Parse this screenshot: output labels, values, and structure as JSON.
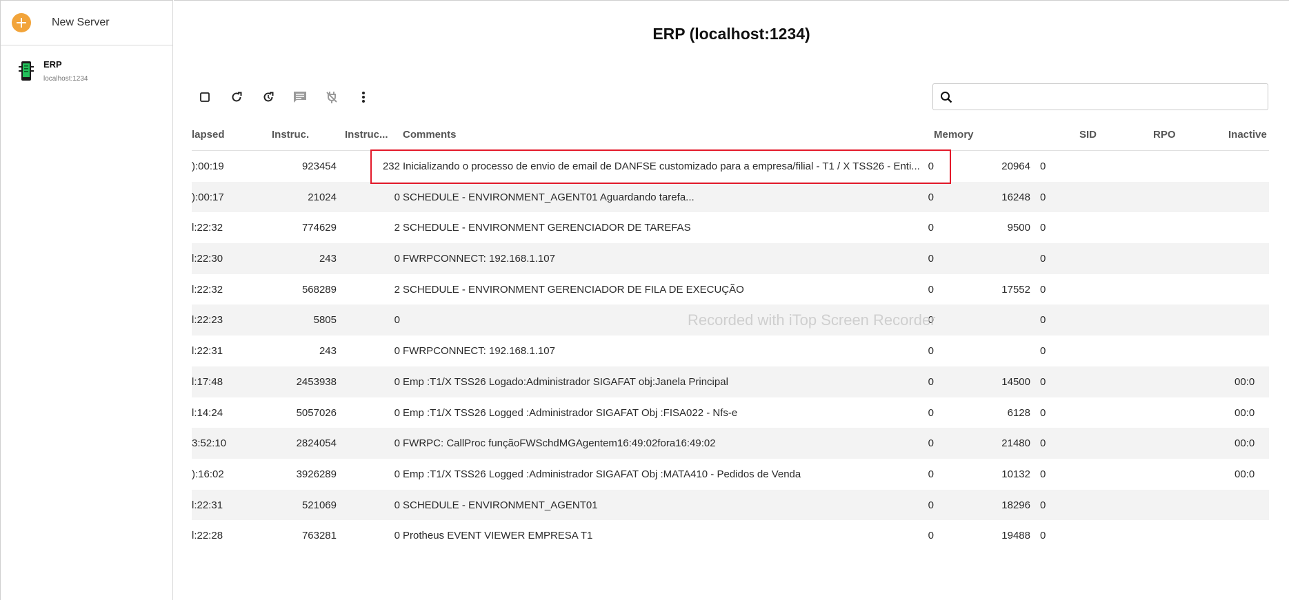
{
  "sidebar": {
    "new_server_label": "New Server",
    "servers": [
      {
        "name": "ERP",
        "host": "localhost:1234",
        "icon": "server-icon"
      }
    ]
  },
  "header": {
    "title": "ERP (localhost:1234)"
  },
  "toolbar": {
    "buttons": [
      {
        "name": "select-all-checkbox",
        "icon": "checkbox-icon"
      },
      {
        "name": "refresh-button",
        "icon": "refresh-icon"
      },
      {
        "name": "auto-refresh-button",
        "icon": "timer-refresh-icon"
      },
      {
        "name": "send-message-button",
        "icon": "message-icon"
      },
      {
        "name": "disconnect-button",
        "icon": "unplug-icon"
      },
      {
        "name": "more-button",
        "icon": "more-vertical-icon"
      }
    ]
  },
  "search": {
    "placeholder": "",
    "value": ""
  },
  "table": {
    "headers": {
      "elapsed": "lapsed",
      "instructions": "Instruc.",
      "instructions2": "Instruc...",
      "comments": "Comments",
      "memory": "Memory",
      "sid": "SID",
      "rpo": "RPO",
      "inactive": "Inactive"
    },
    "rows": [
      {
        "elapsed": "):00:19",
        "instr": "923454",
        "instr2": "232",
        "comments": "Inicializando o processo de envio de email de DANFSE customizado para a empresa/filial - T1 / X TSS26 - Enti...",
        "memory": "0",
        "sid": "20964",
        "rpo": "0",
        "inactive": "",
        "last": ""
      },
      {
        "elapsed": "):00:17",
        "instr": "21024",
        "instr2": "0",
        "comments": "SCHEDULE - ENVIRONMENT_AGENT01 Aguardando tarefa...",
        "memory": "0",
        "sid": "16248",
        "rpo": "0",
        "inactive": "",
        "last": ""
      },
      {
        "elapsed": "l:22:32",
        "instr": "774629",
        "instr2": "2",
        "comments": "SCHEDULE - ENVIRONMENT GERENCIADOR DE TAREFAS",
        "memory": "0",
        "sid": "9500",
        "rpo": "0",
        "inactive": "",
        "last": ""
      },
      {
        "elapsed": "l:22:30",
        "instr": "243",
        "instr2": "0",
        "comments": "FWRPCONNECT: 192.168.1.107",
        "memory": "0",
        "sid": "",
        "rpo": "0",
        "inactive": "",
        "last": ""
      },
      {
        "elapsed": "l:22:32",
        "instr": "568289",
        "instr2": "2",
        "comments": "SCHEDULE - ENVIRONMENT GERENCIADOR DE FILA DE EXECUÇÃO",
        "memory": "0",
        "sid": "17552",
        "rpo": "0",
        "inactive": "",
        "last": ""
      },
      {
        "elapsed": "l:22:23",
        "instr": "5805",
        "instr2": "0",
        "comments": "",
        "memory": "0",
        "sid": "",
        "rpo": "0",
        "inactive": "",
        "last": ""
      },
      {
        "elapsed": "l:22:31",
        "instr": "243",
        "instr2": "0",
        "comments": "FWRPCONNECT: 192.168.1.107",
        "memory": "0",
        "sid": "",
        "rpo": "0",
        "inactive": "",
        "last": ""
      },
      {
        "elapsed": "l:17:48",
        "instr": "2453938",
        "instr2": "0",
        "comments": "Emp :T1/X TSS26 Logado:Administrador SIGAFAT obj:Janela Principal",
        "memory": "0",
        "sid": "14500",
        "rpo": "0",
        "inactive": "",
        "last": "00:0"
      },
      {
        "elapsed": "l:14:24",
        "instr": "5057026",
        "instr2": "0",
        "comments": "Emp :T1/X TSS26 Logged :Administrador SIGAFAT Obj :FISA022 - Nfs-e",
        "memory": "0",
        "sid": "6128",
        "rpo": "0",
        "inactive": "",
        "last": "00:0"
      },
      {
        "elapsed": "3:52:10",
        "instr": "2824054",
        "instr2": "0",
        "comments": "FWRPC: CallProc funçãoFWSchdMGAgentem16:49:02fora16:49:02",
        "memory": "0",
        "sid": "21480",
        "rpo": "0",
        "inactive": "",
        "last": "00:0"
      },
      {
        "elapsed": "):16:02",
        "instr": "3926289",
        "instr2": "0",
        "comments": "Emp :T1/X TSS26 Logged :Administrador SIGAFAT Obj :MATA410 - Pedidos de Venda",
        "memory": "0",
        "sid": "10132",
        "rpo": "0",
        "inactive": "",
        "last": "00:0"
      },
      {
        "elapsed": "l:22:31",
        "instr": "521069",
        "instr2": "0",
        "comments": "SCHEDULE - ENVIRONMENT_AGENT01",
        "memory": "0",
        "sid": "18296",
        "rpo": "0",
        "inactive": "",
        "last": ""
      },
      {
        "elapsed": "l:22:28",
        "instr": "763281",
        "instr2": "0",
        "comments": "Protheus EVENT VIEWER EMPRESA T1",
        "memory": "0",
        "sid": "19488",
        "rpo": "0",
        "inactive": "",
        "last": ""
      }
    ]
  },
  "watermark": "Recorded with iTop Screen Recorder",
  "colors": {
    "accent": "#f2a43a",
    "highlight": "#e3192a",
    "alt_row": "#f3f3f3"
  }
}
